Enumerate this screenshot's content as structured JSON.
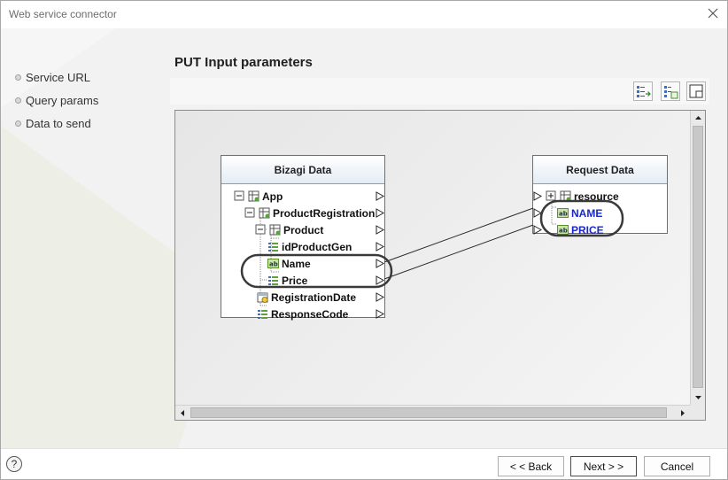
{
  "window": {
    "title": "Web service connector"
  },
  "nav": {
    "items": [
      {
        "label": "Service URL"
      },
      {
        "label": "Query params"
      },
      {
        "label": "Data to send"
      }
    ]
  },
  "section": {
    "title": "PUT Input parameters"
  },
  "source_panel": {
    "title": "Bizagi Data",
    "nodes": [
      {
        "label": "App",
        "icon": "entity-icon"
      },
      {
        "label": "ProductRegistration",
        "icon": "entity-icon"
      },
      {
        "label": "Product",
        "icon": "entity-icon"
      },
      {
        "label": "idProductGen",
        "icon": "number-field-icon"
      },
      {
        "label": "Name",
        "icon": "string-field-icon"
      },
      {
        "label": "Price",
        "icon": "number-field-icon"
      },
      {
        "label": "RegistrationDate",
        "icon": "date-field-icon"
      },
      {
        "label": "ResponseCode",
        "icon": "number-field-icon"
      }
    ]
  },
  "target_panel": {
    "title": "Request Data",
    "nodes": [
      {
        "label": "resource",
        "icon": "entity-icon"
      },
      {
        "label": "NAME",
        "icon": "string-field-icon"
      },
      {
        "label": "PRICE",
        "icon": "string-field-icon"
      }
    ]
  },
  "mappings": [
    {
      "from": "Name",
      "to": "NAME"
    },
    {
      "from": "Price",
      "to": "PRICE"
    }
  ],
  "footer": {
    "help": "?",
    "back": "< < Back",
    "next": "Next > >",
    "cancel": "Cancel"
  },
  "colors": {
    "mapped_target_text": "#1a28c8",
    "highlight_ellipse": "#3a3a3a"
  }
}
